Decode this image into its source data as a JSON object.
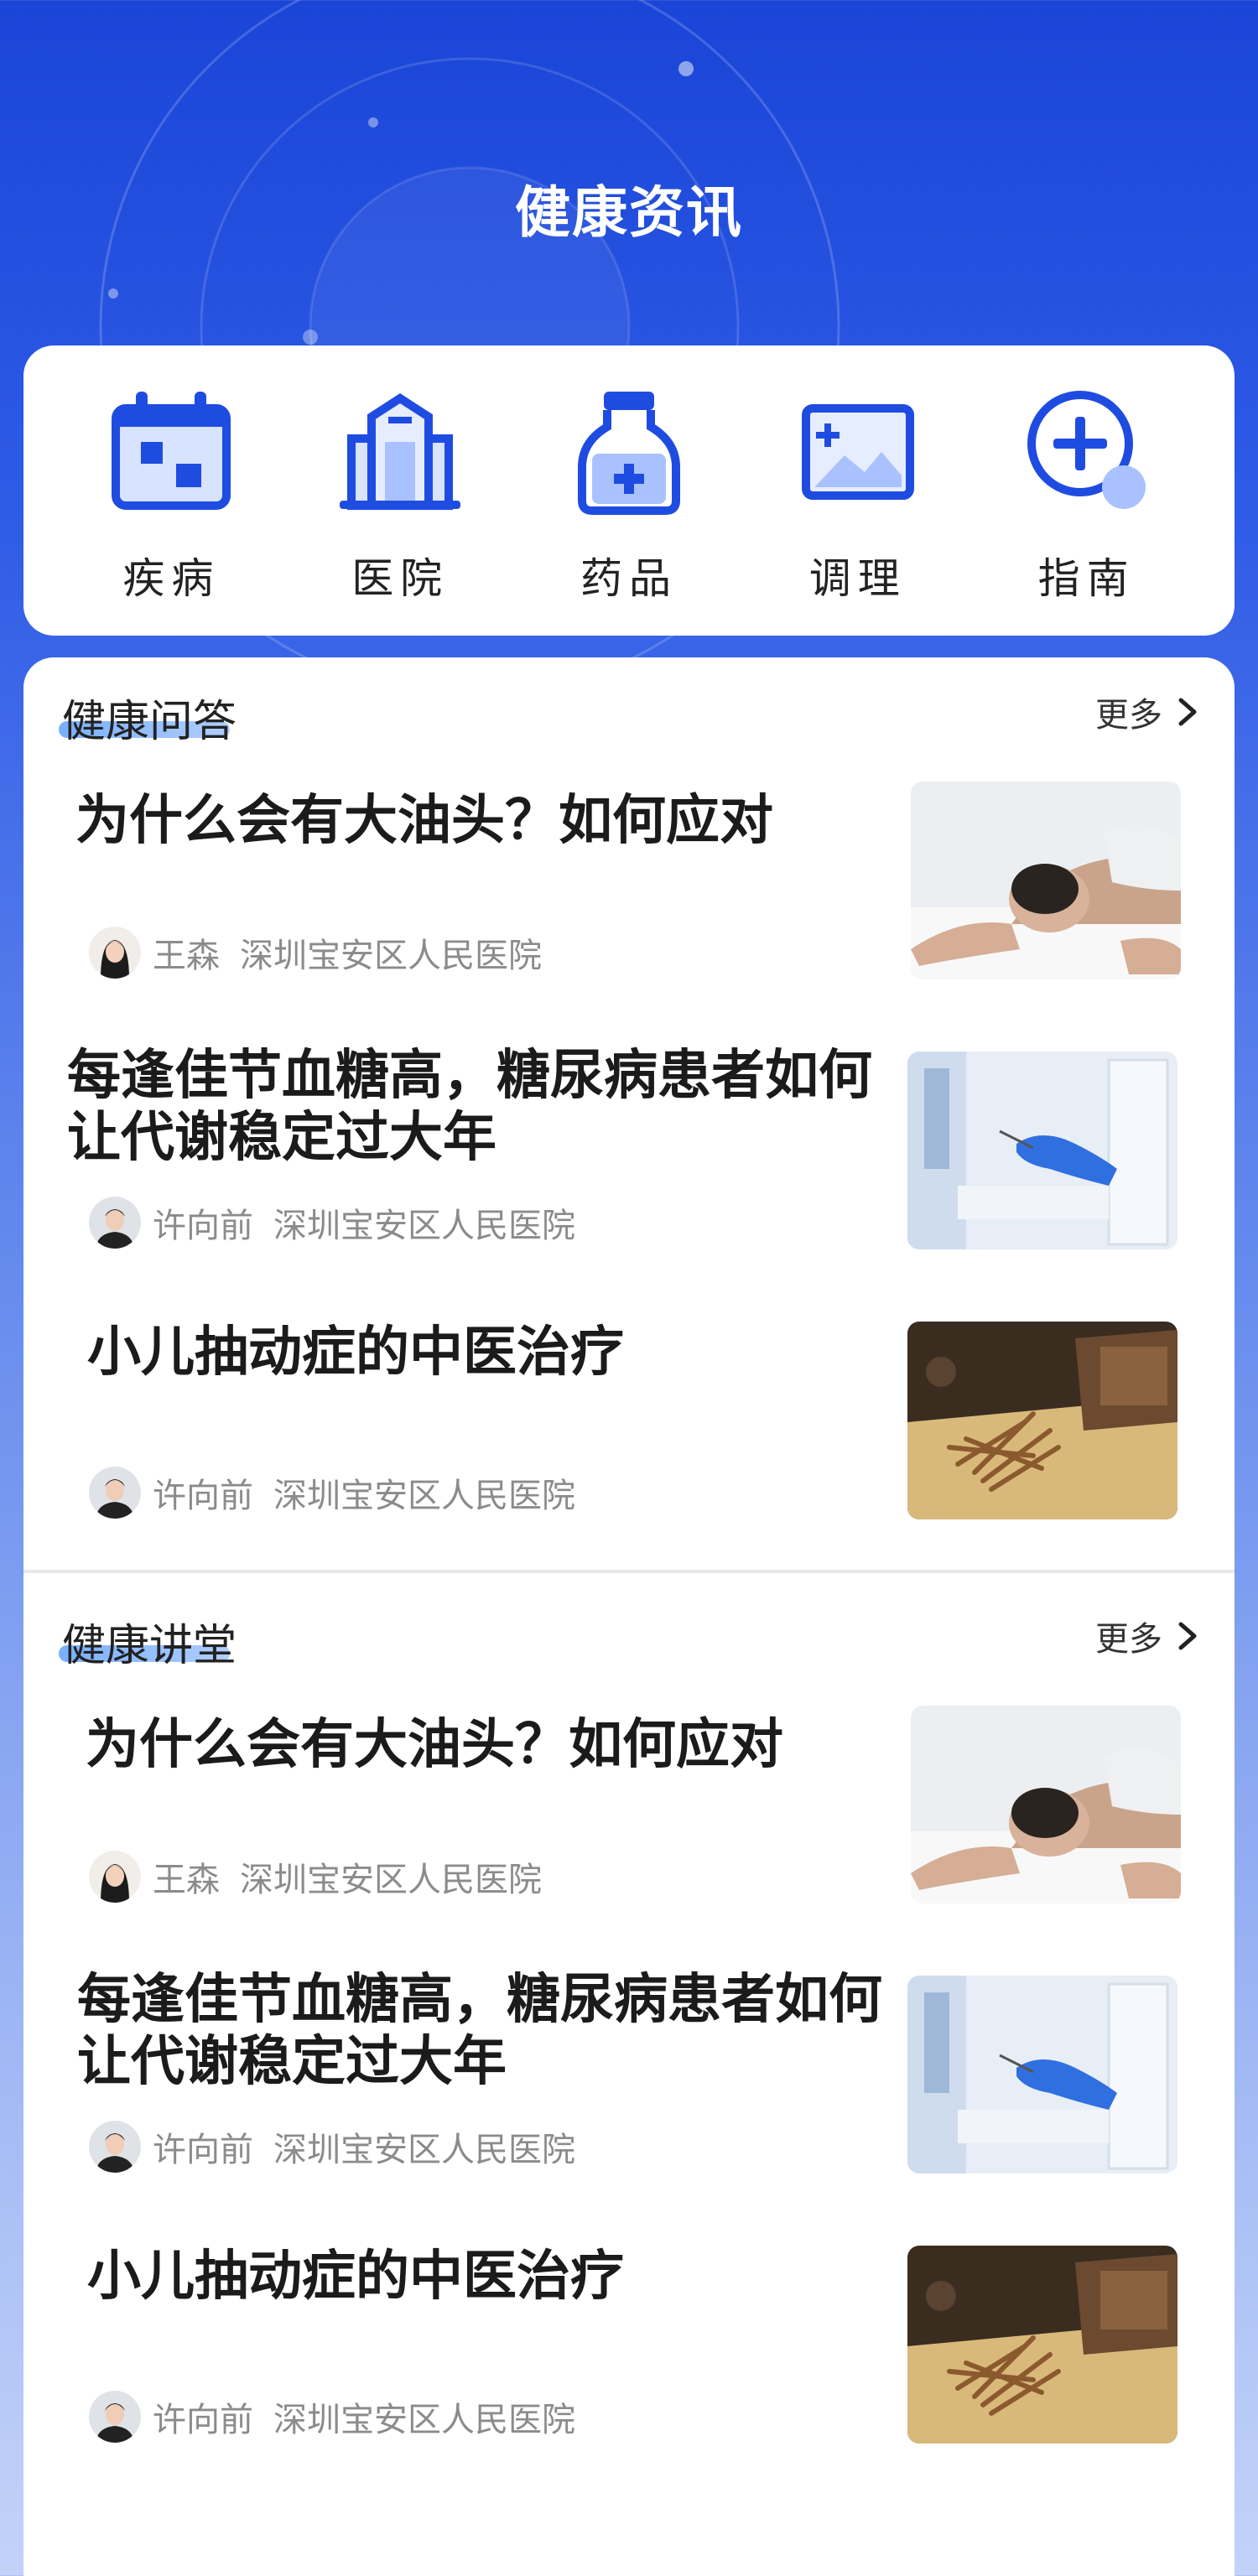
{
  "header": {
    "title": "健康资讯"
  },
  "categories": [
    {
      "label": "疾病",
      "icon": "calendar-icon"
    },
    {
      "label": "医院",
      "icon": "hospital-icon"
    },
    {
      "label": "药品",
      "icon": "medicine-bottle-icon"
    },
    {
      "label": "调理",
      "icon": "picture-icon"
    },
    {
      "label": "指南",
      "icon": "plus-circle-icon"
    }
  ],
  "sections": [
    {
      "title": "健康问答",
      "more": "更多",
      "items": [
        {
          "title": "为什么会有大油头？如何应对",
          "author": "王森",
          "org": "深圳宝安区人民医院",
          "image": "man-lying-head-image"
        },
        {
          "title": "每逢佳节血糖高，糖尿病患者如何让代谢稳定过大年",
          "author": "许向前",
          "org": "深圳宝安区人民医院",
          "image": "lab-glove-image"
        },
        {
          "title": "小儿抽动症的中医治疗",
          "author": "许向前",
          "org": "深圳宝安区人民医院",
          "image": "ginseng-herb-image"
        }
      ]
    },
    {
      "title": "健康讲堂",
      "more": "更多",
      "items": [
        {
          "title": "为什么会有大油头？如何应对",
          "author": "王森",
          "org": "深圳宝安区人民医院",
          "image": "man-lying-head-image"
        },
        {
          "title": "每逢佳节血糖高，糖尿病患者如何让代谢稳定过大年",
          "author": "许向前",
          "org": "深圳宝安区人民医院",
          "image": "lab-glove-image"
        },
        {
          "title": "小儿抽动症的中医治疗",
          "author": "许向前",
          "org": "深圳宝安区人民医院",
          "image": "ginseng-herb-image"
        }
      ]
    }
  ],
  "colors": {
    "primary": "#1f4ce0",
    "icon_light": "#a9c2ff"
  }
}
